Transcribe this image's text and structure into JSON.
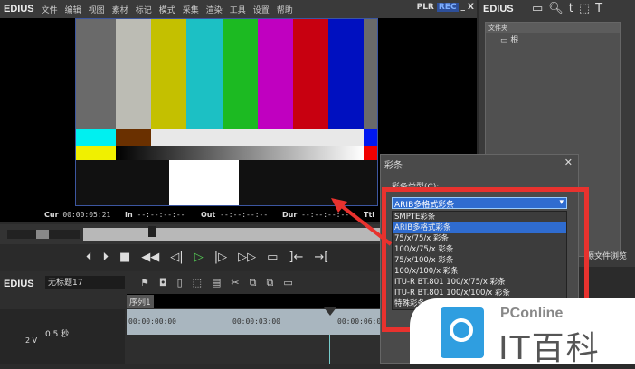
{
  "menubar": {
    "logo": "EDIUS",
    "items": [
      "文件",
      "编辑",
      "视图",
      "素材",
      "标记",
      "模式",
      "采集",
      "渲染",
      "工具",
      "设置",
      "帮助"
    ],
    "plr": "PLR",
    "rec": "REC",
    "minimize": "_",
    "close": "X"
  },
  "timecode": {
    "cur_label": "Cur",
    "cur": "00:00:05:21",
    "in_label": "In",
    "in": "--:--:--:--",
    "out_label": "Out",
    "out": "--:--:--:--",
    "dur_label": "Dur",
    "dur": "--:--:--:--",
    "ttl_label": "Ttl"
  },
  "transport": [
    "⏴",
    "⏵",
    "■",
    "◀◀",
    "◁|",
    "▷",
    "|▷",
    "▷▷",
    "▭",
    "]←",
    "→["
  ],
  "right_panel": {
    "logo": "EDIUS",
    "folder_title": "文件夹",
    "root": "根",
    "source_browser": "源文件浏览"
  },
  "dialog": {
    "title": "彩条",
    "close": "✕",
    "type_label": "彩条类型(C):",
    "selected": "ARIB多格式彩条",
    "options": [
      "SMPTE彩条",
      "ARIB多格式彩条",
      "75/x/75/x 彩条",
      "100/x/75/x 彩条",
      "75/x/100/x 彩条",
      "100/x/100/x 彩条",
      "ITU-R BT.801 100/x/75/x 彩条",
      "ITU-R BT.801 100/x/100/x 彩条",
      "特殊彩条"
    ]
  },
  "timeline": {
    "logo": "EDIUS",
    "project": "无标题17",
    "sequence_tab": "序列1",
    "times": [
      "00:00:00:00",
      "00:00:03:00",
      "00:00:06:00"
    ],
    "step": "0.5 秒",
    "track": "2 V"
  },
  "watermark": {
    "brand": "PConline",
    "name": "IT百科"
  },
  "colors": {
    "accent": "#2f6cd0",
    "annotation": "#e8322e"
  }
}
